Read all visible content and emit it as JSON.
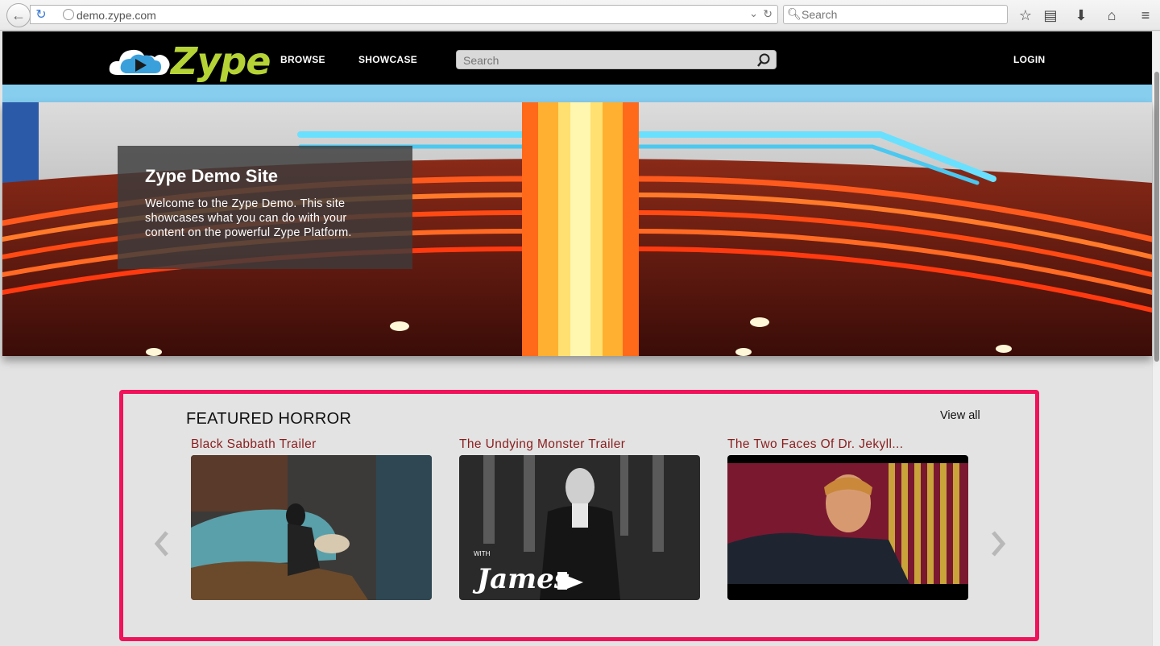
{
  "browser": {
    "url": "demo.zype.com",
    "search_placeholder": "Search"
  },
  "site": {
    "logo_text": "Zype",
    "nav": [
      "BROWSE",
      "SHOWCASE"
    ],
    "search_placeholder": "Search",
    "login_label": "LOGIN"
  },
  "hero": {
    "title": "Zype Demo Site",
    "description": "Welcome to the Zype Demo. This site showcases what you can do with your content on the powerful Zype Platform."
  },
  "featured": {
    "heading": "FEATURED HORROR",
    "view_all": "View all",
    "items": [
      {
        "title": "Black Sabbath Trailer"
      },
      {
        "title": "The Undying Monster Trailer"
      },
      {
        "title": "The Two Faces Of Dr. Jekyll..."
      }
    ],
    "thumb_caption_small": "WITH",
    "thumb_caption_big": "James"
  },
  "colors": {
    "brand_green": "#b5d335",
    "header_black": "#000000",
    "band_blue": "#86cdee",
    "highlight_border": "#f0125a",
    "card_title": "#8a1d1d"
  }
}
